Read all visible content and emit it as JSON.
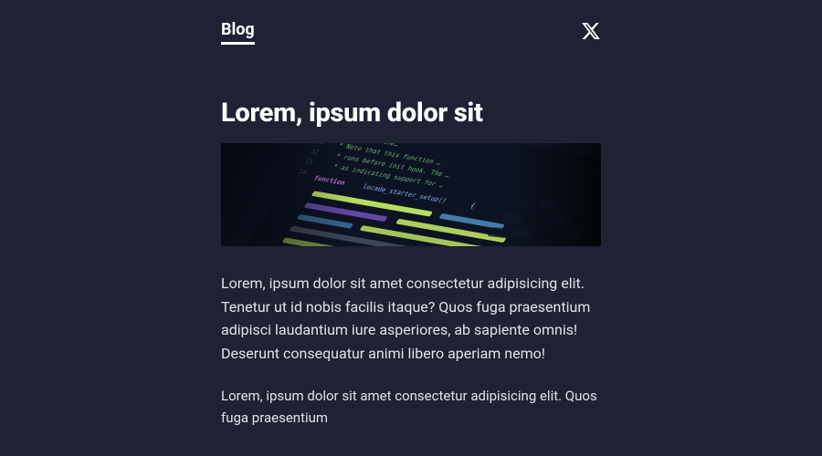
{
  "nav": {
    "brand_label": "Blog"
  },
  "article": {
    "title": "Lorem, ipsum dolor sit",
    "paragraph1": "Lorem, ipsum dolor sit amet consectetur adipisicing elit. Tenetur ut id nobis facilis itaque? Quos fuga praesentium adipisci laudantium iure asperiores, ab sapiente omnis! Deserunt consequatur animi libero aperiam nemo!",
    "paragraph2": "Lorem, ipsum dolor sit amet consectetur adipisicing elit. Quos fuga praesentium"
  }
}
